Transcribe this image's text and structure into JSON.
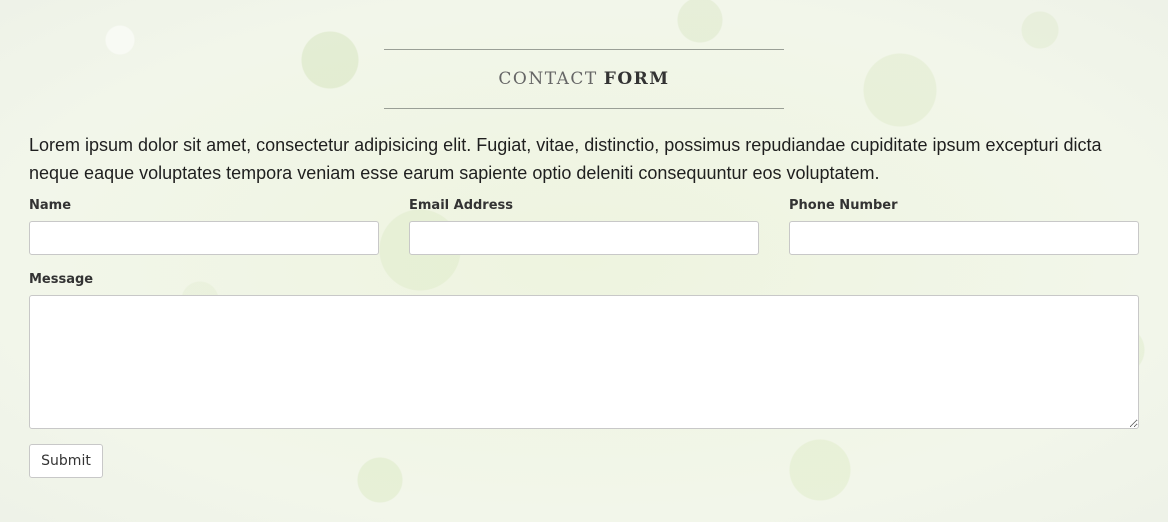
{
  "heading": {
    "light": "CONTACT",
    "bold": "FORM"
  },
  "intro": "Lorem ipsum dolor sit amet, consectetur adipisicing elit. Fugiat, vitae, distinctio, possimus repudiandae cupiditate ipsum excepturi dicta neque eaque voluptates tempora veniam esse earum sapiente optio deleniti consequuntur eos voluptatem.",
  "form": {
    "name_label": "Name",
    "name_value": "",
    "email_label": "Email Address",
    "email_value": "",
    "phone_label": "Phone Number",
    "phone_value": "",
    "message_label": "Message",
    "message_value": "",
    "submit_label": "Submit"
  }
}
